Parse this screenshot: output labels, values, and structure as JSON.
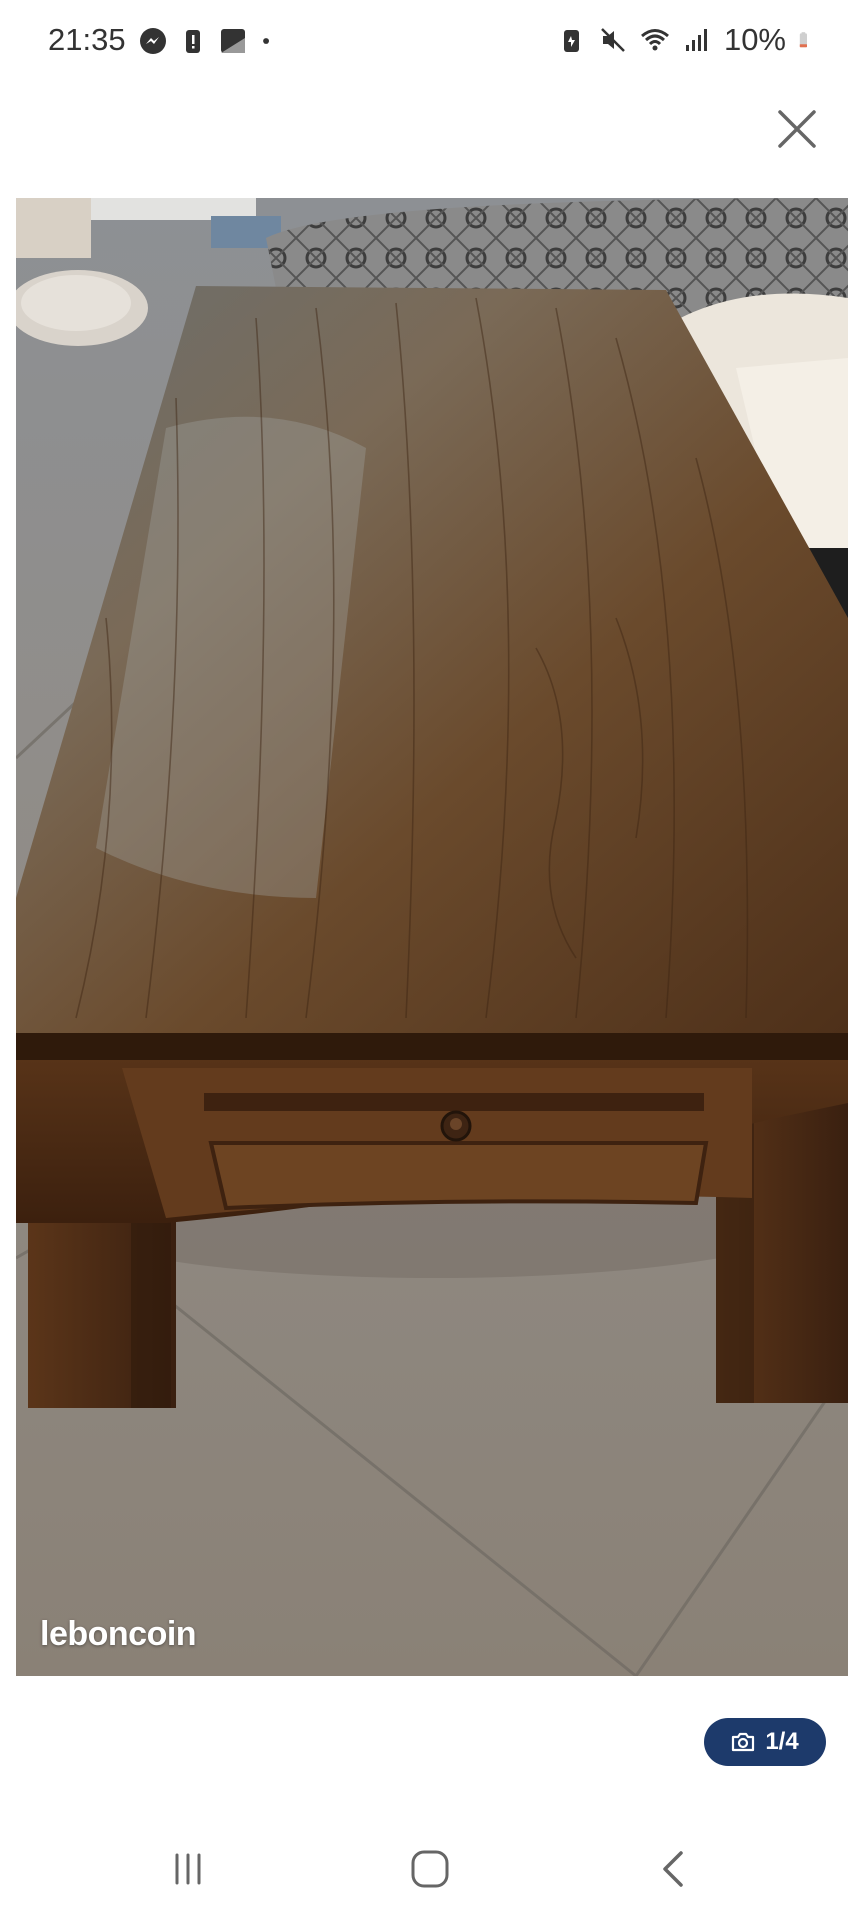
{
  "status_bar": {
    "time": "21:35",
    "battery_percent": "10%",
    "left_icons": [
      "messenger-icon",
      "battery-alert-icon",
      "note-icon",
      "dot-icon"
    ],
    "right_icons": [
      "battery-saver-icon",
      "mute-icon",
      "wifi-icon",
      "signal-icon",
      "battery-icon"
    ]
  },
  "viewer": {
    "close_icon": "close-icon",
    "watermark": "leboncoin",
    "counter": {
      "icon": "camera-icon",
      "label": "1/4"
    }
  },
  "photo": {
    "description_icon": "photo-coffee-table",
    "colors": {
      "wood": "#5b3a20",
      "floor": "#8e8a84",
      "accent": "#1d3a6b"
    }
  },
  "nav_bar": {
    "buttons": [
      "recent-apps-icon",
      "home-icon",
      "back-icon"
    ]
  }
}
